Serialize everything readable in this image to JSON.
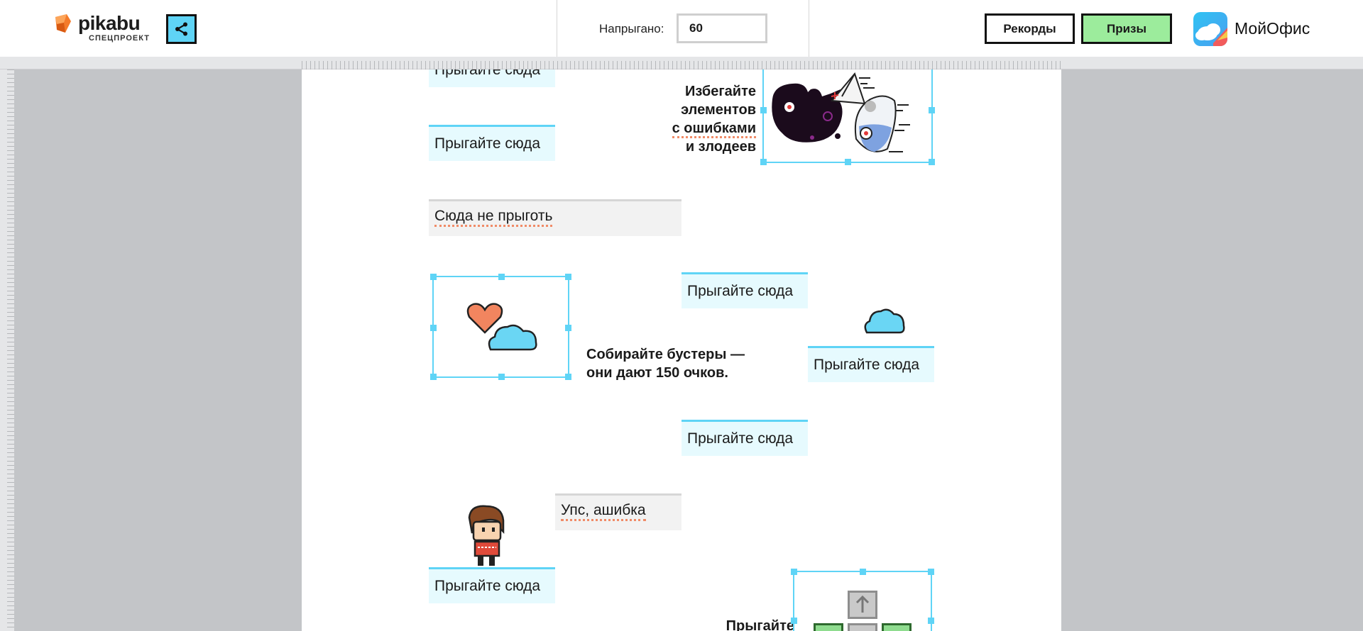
{
  "header": {
    "logo_word": "pikabu",
    "logo_sub": "СПЕЦПРОЕКТ",
    "score_label": "Напрыгано:",
    "score_value": "60",
    "records_label": "Рекорды",
    "prizes_label": "Призы",
    "partner_name": "МойОфис"
  },
  "game": {
    "jump_here": "Прыгайте сюда",
    "no_jump": "Сюда не прыготь",
    "oops": "Упс, ашибка",
    "avoid_tip": [
      "Избегайте",
      "элементов",
      "с ошибками",
      "и злодеев"
    ],
    "boost_tip": [
      "Собирайте бустеры —",
      "они дают 150 очков."
    ],
    "partial_tip": "Прыгайте"
  },
  "colors": {
    "platform_border": "#5fd4f6",
    "platform_bg": "#e6fafe",
    "prizes_bg": "#9cec9c",
    "share_bg": "#5fd4f6",
    "spell_error": "#f08b67"
  },
  "icons": [
    "pikabu-logo-icon",
    "share-icon",
    "moyofis-cloud-icon",
    "heart-icon",
    "cloud-icon",
    "villain-icon",
    "player-character-icon",
    "arrow-up-key-icon"
  ]
}
